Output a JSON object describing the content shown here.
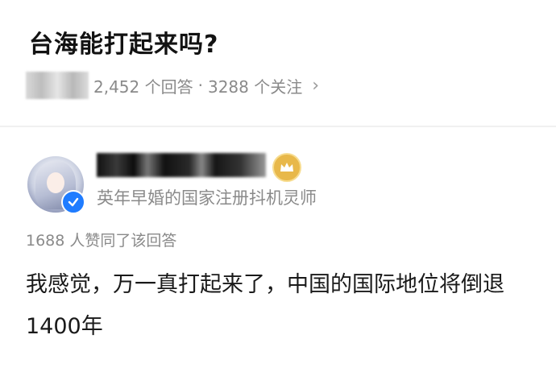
{
  "question": {
    "title": "台海能打起来吗?",
    "answers_count": "2,452 个回答",
    "separator": "·",
    "followers_count": "3288 个关注",
    "chevron": "›"
  },
  "answer": {
    "author_bio": "英年早婚的国家注册抖机灵师",
    "likes": "1688 人赞同了该回答",
    "content": "我感觉，万一真打起来了，中国的国际地位将倒退1400年"
  },
  "colors": {
    "muted_text": "#8a8a8a",
    "verified_blue": "#1f7cff",
    "badge_gold": "#e8b84a"
  },
  "icons": {
    "verified": "verified-icon",
    "badge": "crown-badge-icon",
    "chevron": "chevron-right-icon"
  }
}
